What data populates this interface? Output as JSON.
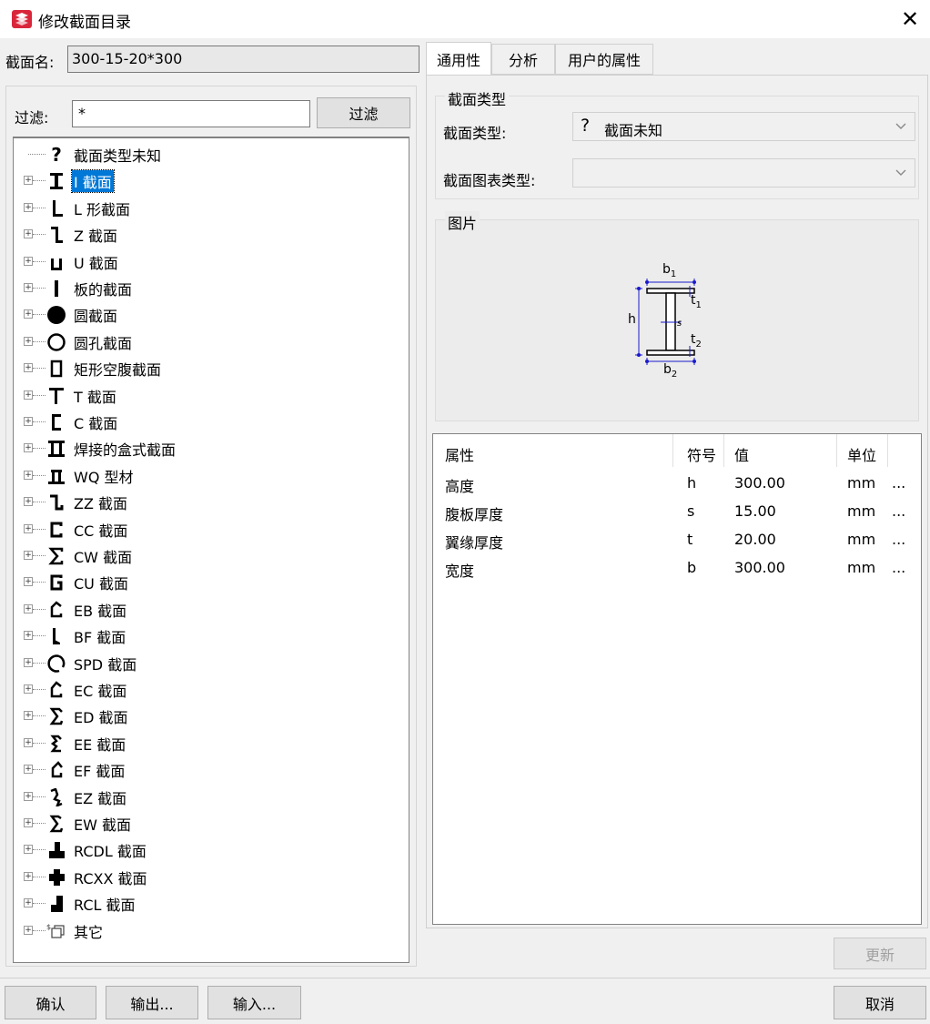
{
  "window": {
    "title": "修改截面目录",
    "close_glyph": "✕"
  },
  "section_name": {
    "label": "截面名:",
    "value": "300-15-20*300"
  },
  "filter": {
    "label": "过滤:",
    "value": "*",
    "button": "过滤"
  },
  "tree": {
    "items": [
      {
        "label": "截面类型未知",
        "icon": "question-mark-icon",
        "expandable": false
      },
      {
        "label": "I 截面",
        "icon": "i-section-icon",
        "expandable": true,
        "selected": true
      },
      {
        "label": "L 形截面",
        "icon": "l-section-icon",
        "expandable": true
      },
      {
        "label": "Z 截面",
        "icon": "z-section-icon",
        "expandable": true
      },
      {
        "label": "U 截面",
        "icon": "u-section-icon",
        "expandable": true
      },
      {
        "label": "板的截面",
        "icon": "plate-section-icon",
        "expandable": true
      },
      {
        "label": "圆截面",
        "icon": "circle-solid-icon",
        "expandable": true
      },
      {
        "label": "圆孔截面",
        "icon": "circle-hollow-icon",
        "expandable": true
      },
      {
        "label": "矩形空腹截面",
        "icon": "rect-hollow-icon",
        "expandable": true
      },
      {
        "label": "T 截面",
        "icon": "t-section-icon",
        "expandable": true
      },
      {
        "label": "C 截面",
        "icon": "c-section-icon",
        "expandable": true
      },
      {
        "label": "焊接的盒式截面",
        "icon": "welded-box-icon",
        "expandable": true
      },
      {
        "label": "WQ 型材",
        "icon": "wq-profile-icon",
        "expandable": true
      },
      {
        "label": "ZZ 截面",
        "icon": "zz-section-icon",
        "expandable": true
      },
      {
        "label": "CC 截面",
        "icon": "cc-section-icon",
        "expandable": true
      },
      {
        "label": "CW 截面",
        "icon": "cw-section-icon",
        "expandable": true
      },
      {
        "label": "CU 截面",
        "icon": "cu-section-icon",
        "expandable": true
      },
      {
        "label": "EB 截面",
        "icon": "eb-section-icon",
        "expandable": true
      },
      {
        "label": "BF 截面",
        "icon": "bf-section-icon",
        "expandable": true
      },
      {
        "label": "SPD 截面",
        "icon": "spd-section-icon",
        "expandable": true
      },
      {
        "label": "EC 截面",
        "icon": "ec-section-icon",
        "expandable": true
      },
      {
        "label": "ED 截面",
        "icon": "ed-section-icon",
        "expandable": true
      },
      {
        "label": "EE 截面",
        "icon": "ee-section-icon",
        "expandable": true
      },
      {
        "label": "EF 截面",
        "icon": "ef-section-icon",
        "expandable": true
      },
      {
        "label": "EZ 截面",
        "icon": "ez-section-icon",
        "expandable": true
      },
      {
        "label": "EW 截面",
        "icon": "ew-section-icon",
        "expandable": true
      },
      {
        "label": "RCDL 截面",
        "icon": "rcdl-section-icon",
        "expandable": true
      },
      {
        "label": "RCXX 截面",
        "icon": "rcxx-section-icon",
        "expandable": true
      },
      {
        "label": "RCL 截面",
        "icon": "rcl-section-icon",
        "expandable": true
      },
      {
        "label": "其它",
        "icon": "other-section-icon",
        "expandable": true
      }
    ]
  },
  "tabs": [
    {
      "label": "通用性",
      "active": true
    },
    {
      "label": "分析",
      "active": false
    },
    {
      "label": "用户的属性",
      "active": false
    }
  ],
  "section_type_group": {
    "title": "截面类型",
    "type_label": "截面类型:",
    "type_value": "截面未知",
    "type_icon": "question-mark-icon",
    "chart_type_label": "截面图表类型:",
    "chart_type_value": ""
  },
  "picture_group": {
    "title": "图片",
    "diagram_labels": {
      "b1": "b",
      "b1_sub": "1",
      "t1": "t",
      "t1_sub": "1",
      "h": "h",
      "s": "s",
      "t2": "t",
      "t2_sub": "2",
      "b2": "b",
      "b2_sub": "2"
    },
    "dimension_color": "#1a1acc"
  },
  "properties": {
    "headers": {
      "property": "属性",
      "symbol": "符号",
      "value": "值",
      "unit": "单位"
    },
    "rows": [
      {
        "property": "高度",
        "symbol": "h",
        "value": "300.00",
        "unit": "mm",
        "more": "..."
      },
      {
        "property": "腹板厚度",
        "symbol": "s",
        "value": "15.00",
        "unit": "mm",
        "more": "..."
      },
      {
        "property": "翼缘厚度",
        "symbol": "t",
        "value": "20.00",
        "unit": "mm",
        "more": "..."
      },
      {
        "property": "宽度",
        "symbol": "b",
        "value": "300.00",
        "unit": "mm",
        "more": "..."
      }
    ]
  },
  "buttons": {
    "update": "更新",
    "ok": "确认",
    "export": "输出...",
    "import": "输入...",
    "cancel": "取消"
  },
  "colors": {
    "selection": "#0078d7",
    "app_icon": "#d9263a"
  }
}
